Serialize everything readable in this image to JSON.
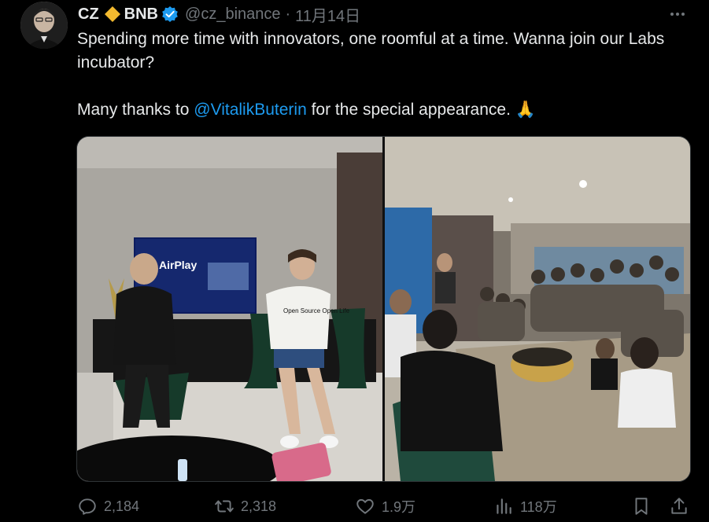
{
  "author": {
    "display_name": "CZ",
    "name_suffix": "BNB",
    "handle": "@cz_binance",
    "separator": "·",
    "date": "11月14日",
    "avatar_icon": "avatar-photo",
    "brand_icon": "bnb-diamond-icon",
    "verified_icon": "verified-badge-icon"
  },
  "tweet": {
    "line1": "Spending more time with innovators, one roomful at a time. Wanna join our Labs incubator?",
    "line2_prefix": "Many thanks to ",
    "mention": "@VitalikButerin",
    "line2_suffix": " for the special appearance. ",
    "emoji": "🙏"
  },
  "media": {
    "photos": [
      {
        "name": "stage-photo",
        "tv_text": "AirPlay",
        "shirt_text": "Open Source Open Life"
      },
      {
        "name": "audience-photo"
      }
    ]
  },
  "actions": {
    "replies": "2,184",
    "reposts": "2,318",
    "likes": "1.9万",
    "views": "118万"
  },
  "colors": {
    "background": "#000000",
    "text": "#e7e9ea",
    "secondary": "#71767b",
    "accent": "#1d9bf0",
    "bnb": "#f3ba2f"
  }
}
